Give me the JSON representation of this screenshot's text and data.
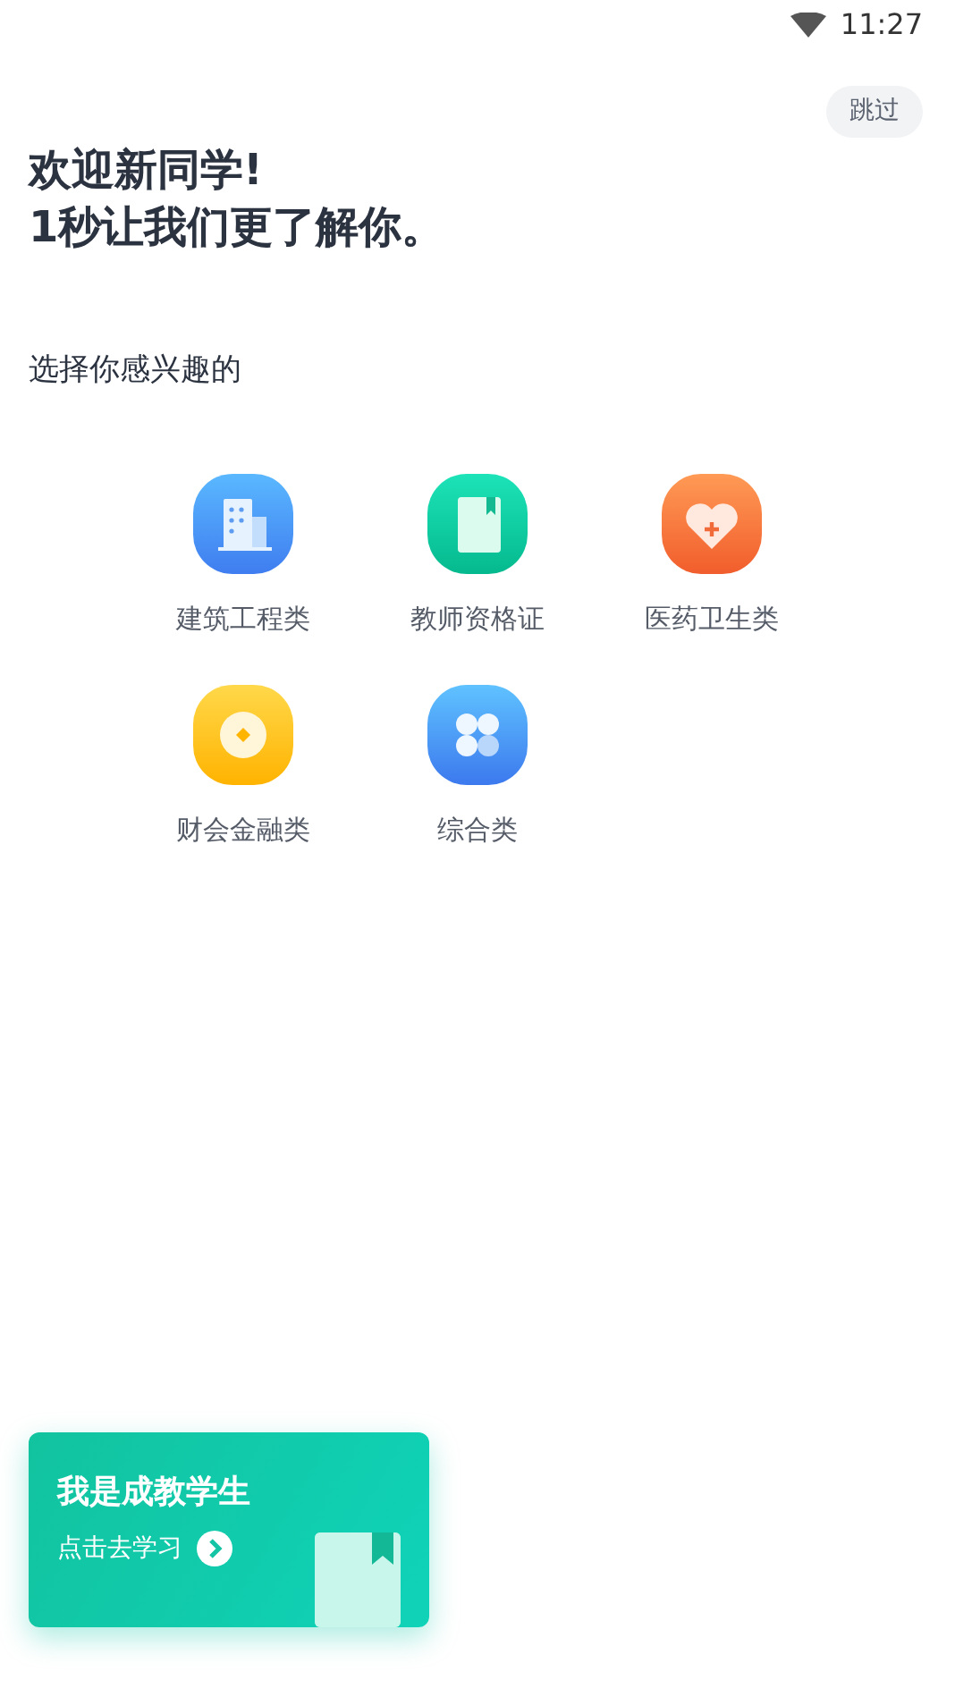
{
  "status_bar": {
    "time": "11:27"
  },
  "skip_button": "跳过",
  "greeting": [
    "欢迎新同学!",
    "1秒让我们更了解你。"
  ],
  "prompt": "选择你感兴趣的",
  "categories": [
    {
      "label": "建筑工程类",
      "kind": "building"
    },
    {
      "label": "教师资格证",
      "kind": "book"
    },
    {
      "label": "医药卫生类",
      "kind": "medical"
    },
    {
      "label": "财会金融类",
      "kind": "coin"
    },
    {
      "label": "综合类",
      "kind": "clover"
    }
  ],
  "student_card": {
    "title": "我是成教学生",
    "link": "点击去学习"
  }
}
